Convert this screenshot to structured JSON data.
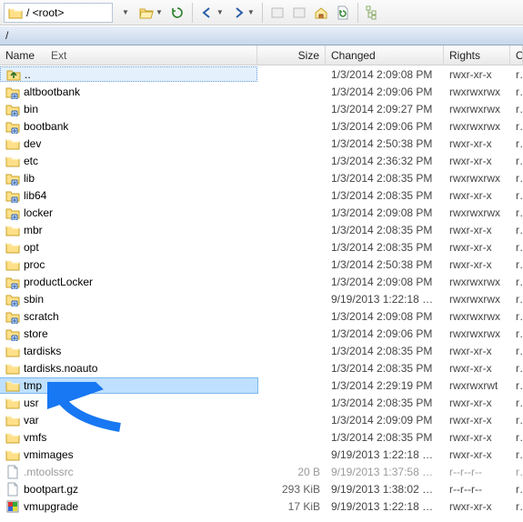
{
  "address": "/ <root>",
  "path": "/",
  "columns": {
    "name": "Name",
    "ext": "Ext",
    "size": "Size",
    "changed": "Changed",
    "rights": "Rights",
    "owner": "Owner"
  },
  "rows": [
    {
      "type": "parent",
      "icon": "up",
      "name": "..",
      "size": "",
      "changed": "1/3/2014 2:09:08 PM",
      "rights": "rwxr-xr-x",
      "owner": "root"
    },
    {
      "type": "link",
      "icon": "folder-l",
      "name": "altbootbank",
      "size": "",
      "changed": "1/3/2014 2:09:06 PM",
      "rights": "rwxrwxrwx",
      "owner": "root"
    },
    {
      "type": "link",
      "icon": "folder-l",
      "name": "bin",
      "size": "",
      "changed": "1/3/2014 2:09:27 PM",
      "rights": "rwxrwxrwx",
      "owner": "root"
    },
    {
      "type": "link",
      "icon": "folder-l",
      "name": "bootbank",
      "size": "",
      "changed": "1/3/2014 2:09:06 PM",
      "rights": "rwxrwxrwx",
      "owner": "root"
    },
    {
      "type": "dir",
      "icon": "folder",
      "name": "dev",
      "size": "",
      "changed": "1/3/2014 2:50:38 PM",
      "rights": "rwxr-xr-x",
      "owner": "root"
    },
    {
      "type": "dir",
      "icon": "folder",
      "name": "etc",
      "size": "",
      "changed": "1/3/2014 2:36:32 PM",
      "rights": "rwxr-xr-x",
      "owner": "root"
    },
    {
      "type": "link",
      "icon": "folder-l",
      "name": "lib",
      "size": "",
      "changed": "1/3/2014 2:08:35 PM",
      "rights": "rwxrwxrwx",
      "owner": "root"
    },
    {
      "type": "link",
      "icon": "folder-l",
      "name": "lib64",
      "size": "",
      "changed": "1/3/2014 2:08:35 PM",
      "rights": "rwxr-xr-x",
      "owner": "root"
    },
    {
      "type": "link",
      "icon": "folder-l",
      "name": "locker",
      "size": "",
      "changed": "1/3/2014 2:09:08 PM",
      "rights": "rwxrwxrwx",
      "owner": "root"
    },
    {
      "type": "dir",
      "icon": "folder",
      "name": "mbr",
      "size": "",
      "changed": "1/3/2014 2:08:35 PM",
      "rights": "rwxr-xr-x",
      "owner": "root"
    },
    {
      "type": "dir",
      "icon": "folder",
      "name": "opt",
      "size": "",
      "changed": "1/3/2014 2:08:35 PM",
      "rights": "rwxr-xr-x",
      "owner": "root"
    },
    {
      "type": "dir",
      "icon": "folder",
      "name": "proc",
      "size": "",
      "changed": "1/3/2014 2:50:38 PM",
      "rights": "rwxr-xr-x",
      "owner": "root"
    },
    {
      "type": "link",
      "icon": "folder-l",
      "name": "productLocker",
      "size": "",
      "changed": "1/3/2014 2:09:08 PM",
      "rights": "rwxrwxrwx",
      "owner": "root"
    },
    {
      "type": "link",
      "icon": "folder-l",
      "name": "sbin",
      "size": "",
      "changed": "9/19/2013 1:22:18 …",
      "rights": "rwxrwxrwx",
      "owner": "root"
    },
    {
      "type": "link",
      "icon": "folder-l",
      "name": "scratch",
      "size": "",
      "changed": "1/3/2014 2:09:08 PM",
      "rights": "rwxrwxrwx",
      "owner": "root"
    },
    {
      "type": "link",
      "icon": "folder-l",
      "name": "store",
      "size": "",
      "changed": "1/3/2014 2:09:06 PM",
      "rights": "rwxrwxrwx",
      "owner": "root"
    },
    {
      "type": "dir",
      "icon": "folder",
      "name": "tardisks",
      "size": "",
      "changed": "1/3/2014 2:08:35 PM",
      "rights": "rwxr-xr-x",
      "owner": "root"
    },
    {
      "type": "dir",
      "icon": "folder",
      "name": "tardisks.noauto",
      "size": "",
      "changed": "1/3/2014 2:08:35 PM",
      "rights": "rwxr-xr-x",
      "owner": "root"
    },
    {
      "type": "dir",
      "icon": "folder",
      "name": "tmp",
      "selected": true,
      "size": "",
      "changed": "1/3/2014 2:29:19 PM",
      "rights": "rwxrwxrwt",
      "owner": "root"
    },
    {
      "type": "dir",
      "icon": "folder",
      "name": "usr",
      "size": "",
      "changed": "1/3/2014 2:08:35 PM",
      "rights": "rwxr-xr-x",
      "owner": "root"
    },
    {
      "type": "dir",
      "icon": "folder",
      "name": "var",
      "size": "",
      "changed": "1/3/2014 2:09:09 PM",
      "rights": "rwxr-xr-x",
      "owner": "root"
    },
    {
      "type": "dir",
      "icon": "folder",
      "name": "vmfs",
      "size": "",
      "changed": "1/3/2014 2:08:35 PM",
      "rights": "rwxr-xr-x",
      "owner": "root"
    },
    {
      "type": "dir",
      "icon": "folder",
      "name": "vmimages",
      "size": "",
      "changed": "9/19/2013 1:22:18 …",
      "rights": "rwxr-xr-x",
      "owner": "root"
    },
    {
      "type": "file",
      "icon": "file",
      "name": ".mtoolssrc",
      "dim": true,
      "size": "20 B",
      "changed": "9/19/2013 1:37:58 …",
      "rights": "r--r--r--",
      "owner": "root"
    },
    {
      "type": "file",
      "icon": "file",
      "name": "bootpart.gz",
      "size": "293 KiB",
      "changed": "9/19/2013 1:38:02 …",
      "rights": "r--r--r--",
      "owner": "root"
    },
    {
      "type": "file",
      "icon": "exe",
      "name": "vmupgrade",
      "size": "17 KiB",
      "changed": "9/19/2013 1:22:18 …",
      "rights": "rwxr-xr-x",
      "owner": "root"
    }
  ]
}
